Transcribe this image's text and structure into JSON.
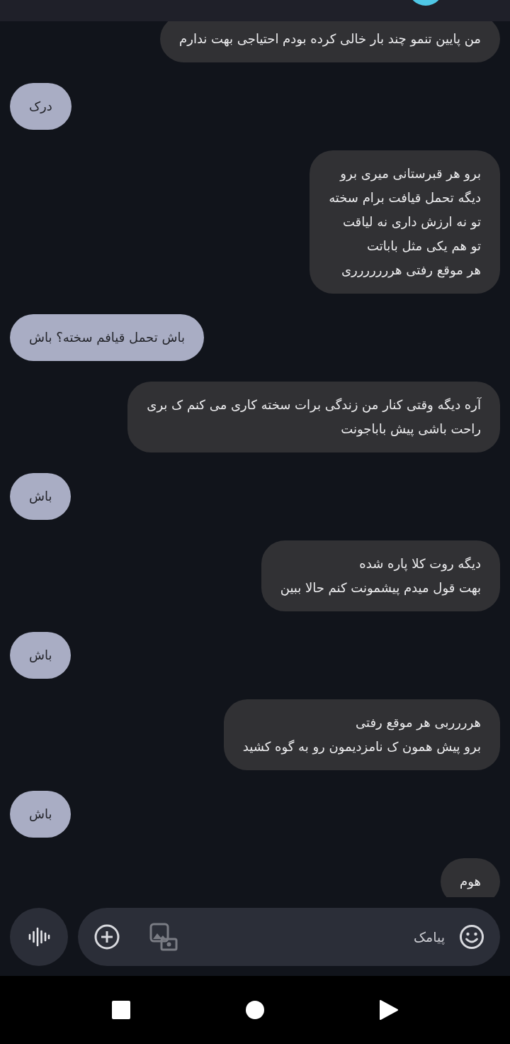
{
  "messages": [
    {
      "kind": "outgoing",
      "text": "من پایین تنمو چند بار خالی کرده بودم احتیاجی بهت ندارم"
    },
    {
      "kind": "incoming",
      "text": "درک"
    },
    {
      "kind": "outgoing",
      "text": "برو هر قبرستانی میری برو\nدیگه تحمل قیافت برام سخته\nتو نه ارزش داری نه لیاقت\nتو هم یکی مثل باباتت\nهر موقع رفتی هررررررری"
    },
    {
      "kind": "incoming",
      "text": "باش تحمل قیافم سخته؟ باش"
    },
    {
      "kind": "outgoing",
      "text": "آره دیگه وقتی کنار من زندگی برات سخته کاری می کنم ک بری\nراحت باشی پیش باباجونت"
    },
    {
      "kind": "incoming",
      "text": "باش"
    },
    {
      "kind": "outgoing",
      "text": "دیگه روت کلا پاره شده\nبهت قول میدم پیشمونت کنم حالا ببین"
    },
    {
      "kind": "incoming",
      "text": "باش"
    },
    {
      "kind": "outgoing",
      "text": "هرررربی هر موقع رفتی\nبرو پیش همون ک نامزدیمون رو به گوه کشید"
    },
    {
      "kind": "incoming",
      "text": "باش"
    },
    {
      "kind": "outgoing",
      "text": "هوم"
    }
  ],
  "composer": {
    "placeholder": "پیامک"
  }
}
